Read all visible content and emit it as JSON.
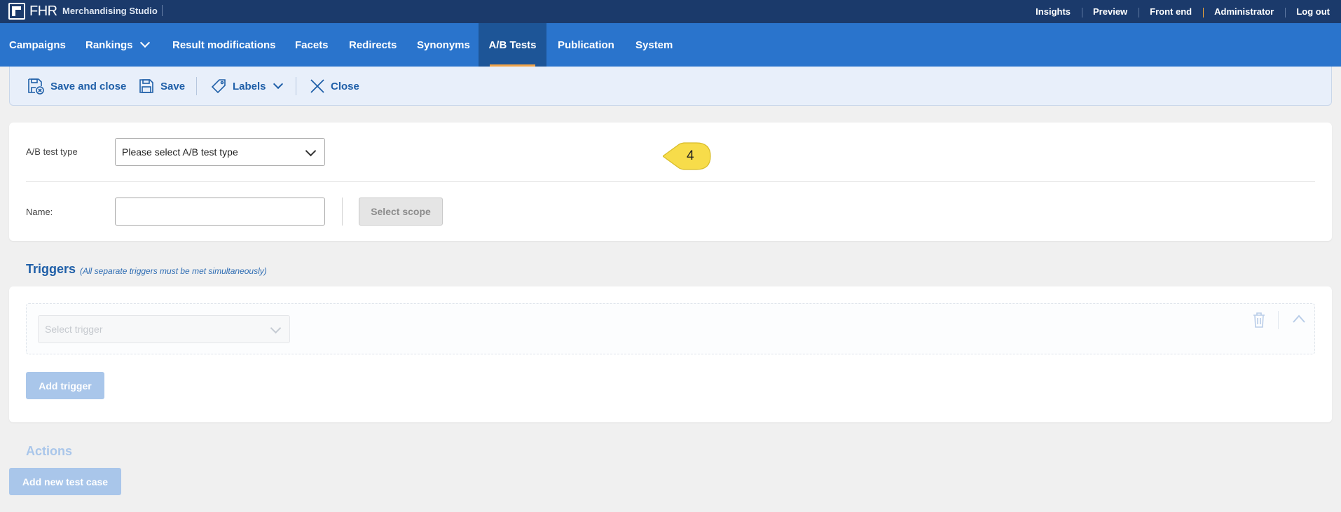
{
  "app": {
    "logo_text": "FHR",
    "product_name": "Merchandising Studio"
  },
  "top_links": [
    "Insights",
    "Preview",
    "Front end",
    "Administrator",
    "Log out"
  ],
  "nav": {
    "campaigns": "Campaigns",
    "rankings": "Rankings",
    "result_modifications": "Result modifications",
    "facets": "Facets",
    "redirects": "Redirects",
    "synonyms": "Synonyms",
    "ab_tests": "A/B Tests",
    "publication": "Publication",
    "system": "System",
    "active": "A/B Tests"
  },
  "toolbar": {
    "save_and_close": "Save and close",
    "save": "Save",
    "labels": "Labels",
    "close": "Close"
  },
  "form": {
    "ab_test_type_label": "A/B test type",
    "ab_test_type_value": "Please select A/B test type",
    "name_label": "Name:",
    "name_value": "",
    "select_scope": "Select scope"
  },
  "callout": {
    "number": "4",
    "color": "#f7dc4a"
  },
  "triggers": {
    "title": "Triggers",
    "subtitle": "(All separate triggers must be met simultaneously)",
    "select_placeholder": "Select trigger",
    "add_trigger": "Add trigger"
  },
  "actions": {
    "title": "Actions",
    "add_new_test_case": "Add new test case"
  },
  "colors": {
    "topbar": "#1b3a6b",
    "nav": "#2a74cc",
    "nav_active": "#1d5597",
    "active_underline": "#f0a44a",
    "accent_text": "#1f5fa8",
    "disabled_button": "#a9c6ea"
  }
}
